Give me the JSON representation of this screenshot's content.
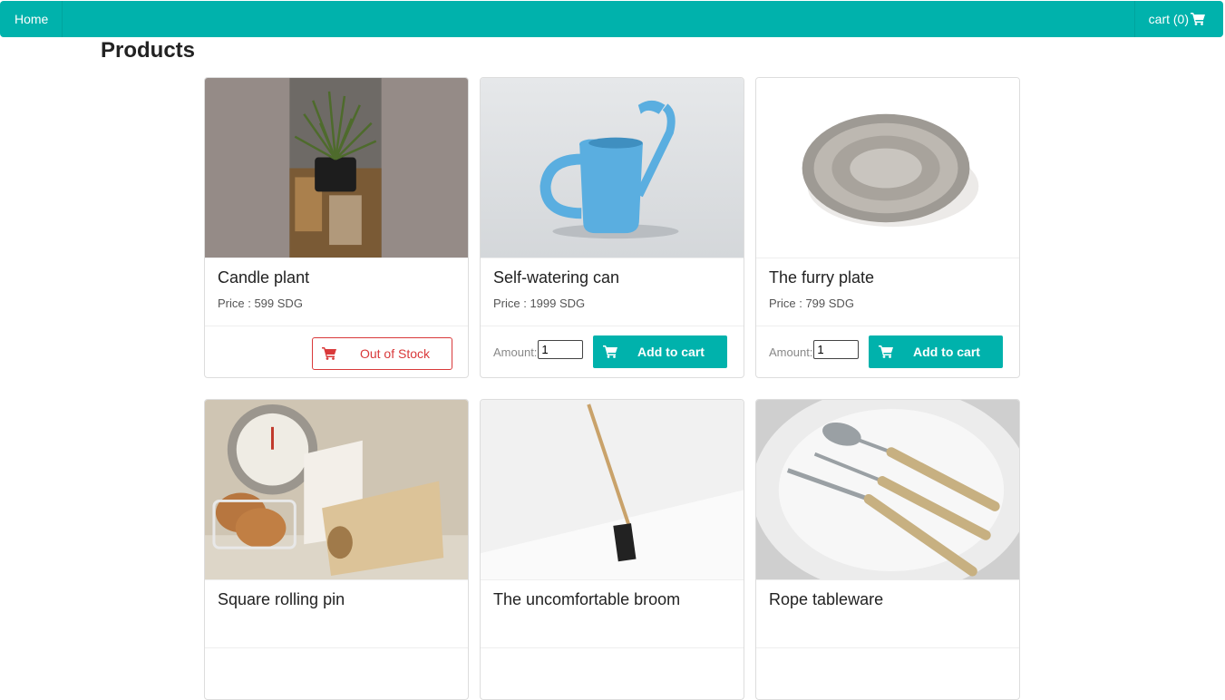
{
  "nav": {
    "home_label": "Home",
    "cart_label": "cart (0)",
    "color": "#00b2ac"
  },
  "page": {
    "title": "Products"
  },
  "products": [
    {
      "title": "Candle plant",
      "price": "Price : 599 SDG",
      "status": "Out of Stock",
      "image": "plant-in-glasses"
    },
    {
      "title": "Self-watering can",
      "price": "Price : 1999 SDG",
      "amount_label": "Amount:",
      "amount_value": "1",
      "button": "Add to cart",
      "image": "blue-watering-can"
    },
    {
      "title": "The furry plate",
      "price": "Price : 799 SDG",
      "amount_label": "Amount:",
      "amount_value": "1",
      "button": "Add to cart",
      "image": "furry-plate"
    },
    {
      "title": "Square rolling pin",
      "price": "",
      "image": "kitchen-scale-eggs-rolling-pin"
    },
    {
      "title": "The uncomfortable broom",
      "price": "",
      "image": "broom-against-wall"
    },
    {
      "title": "Rope tableware",
      "price": "",
      "image": "rope-cutlery-plate"
    }
  ]
}
